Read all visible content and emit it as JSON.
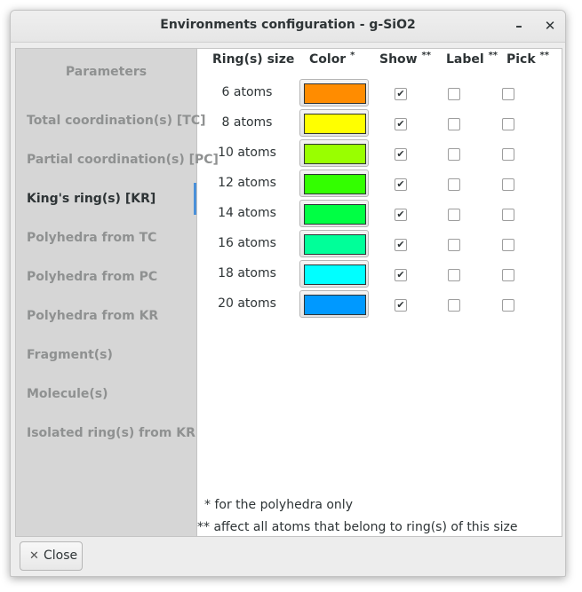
{
  "window": {
    "title": "Environments configuration - g-SiO2",
    "minimize_glyph": "–",
    "close_glyph": "✕"
  },
  "sidebar": {
    "header": "Parameters",
    "items": [
      {
        "label": "Total coordination(s) [TC]",
        "active": false
      },
      {
        "label": "Partial coordination(s) [PC]",
        "active": false
      },
      {
        "label": "King's ring(s) [KR]",
        "active": true
      },
      {
        "label": "Polyhedra from TC",
        "active": false
      },
      {
        "label": "Polyhedra from PC",
        "active": false
      },
      {
        "label": "Polyhedra from KR",
        "active": false
      },
      {
        "label": "Fragment(s)",
        "active": false
      },
      {
        "label": "Molecule(s)",
        "active": false
      },
      {
        "label": "Isolated ring(s) from KR",
        "active": false
      }
    ]
  },
  "table": {
    "headers": {
      "size": "Ring(s) size",
      "color": "Color",
      "color_mark": "*",
      "show": "Show",
      "show_mark": "**",
      "label": "Label",
      "label_mark": "**",
      "pick": "Pick",
      "pick_mark": "**"
    },
    "rows": [
      {
        "size": "6 atoms",
        "color": "#ff8c00",
        "show": true,
        "label": false,
        "pick": false
      },
      {
        "size": "8 atoms",
        "color": "#ffff00",
        "show": true,
        "label": false,
        "pick": false
      },
      {
        "size": "10 atoms",
        "color": "#99ff00",
        "show": true,
        "label": false,
        "pick": false
      },
      {
        "size": "12 atoms",
        "color": "#33ff00",
        "show": true,
        "label": false,
        "pick": false
      },
      {
        "size": "14 atoms",
        "color": "#00ff44",
        "show": true,
        "label": false,
        "pick": false
      },
      {
        "size": "16 atoms",
        "color": "#00ff99",
        "show": true,
        "label": false,
        "pick": false
      },
      {
        "size": "18 atoms",
        "color": "#00ffff",
        "show": true,
        "label": false,
        "pick": false
      },
      {
        "size": "20 atoms",
        "color": "#0099ff",
        "show": true,
        "label": false,
        "pick": false
      }
    ]
  },
  "notes": {
    "polyhedra": "* for the polyhedra only",
    "affect": "** affect all atoms that belong to ring(s) of this size"
  },
  "footer": {
    "close_label": "Close",
    "close_icon": "✕"
  },
  "check_glyph": "✔"
}
